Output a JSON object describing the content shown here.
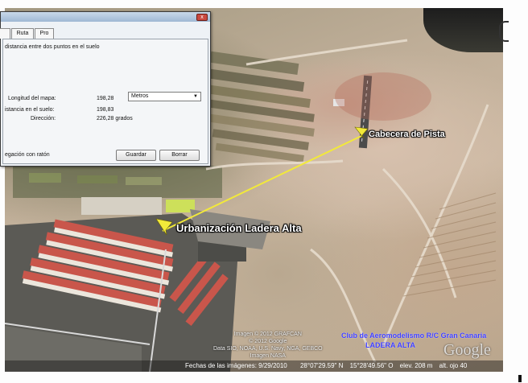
{
  "dialog": {
    "tabs": [
      "",
      "Ruta",
      "Pro"
    ],
    "description": "distancia entre dos puntos en el suelo",
    "map_length_label": "Longitud del mapa:",
    "map_length_value": "198,28",
    "unit_selected": "Metros",
    "ground_distance_label": "istancia en el suelo:",
    "ground_distance_value": "198,83",
    "direction_label": "Dirección:",
    "direction_value": "226,28 grados",
    "mouse_navigation_label": "egación con ratón",
    "save_button": "Guardar",
    "clear_button": "Borrar",
    "close_symbol": "x"
  },
  "map": {
    "placemark_runway": "Cabecera de Pista",
    "placemark_urbanization": "Urbanización Ladera Alta",
    "measure_line_color": "#f2e93a",
    "attribution_lines": [
      "Imagen © 2012 GRAFCAN",
      "© 2012 Google",
      "Data SIO, NOAA, U.S. Navy, NGA, GEBCO",
      "Imagen NASA"
    ],
    "club_line1": "Club de Aeromodelismo R/C Gran Canaria",
    "club_line2": "LADERA ALTA",
    "logo_text": "Google"
  },
  "statusbar": {
    "imagery_date": "Fechas de las imágenes: 9/29/2010",
    "latitude": "28°07'29.59\" N",
    "longitude": "15°28'49.56\" O",
    "elevation": "elev.  208 m",
    "eye_altitude": "alt. ojo  40"
  }
}
